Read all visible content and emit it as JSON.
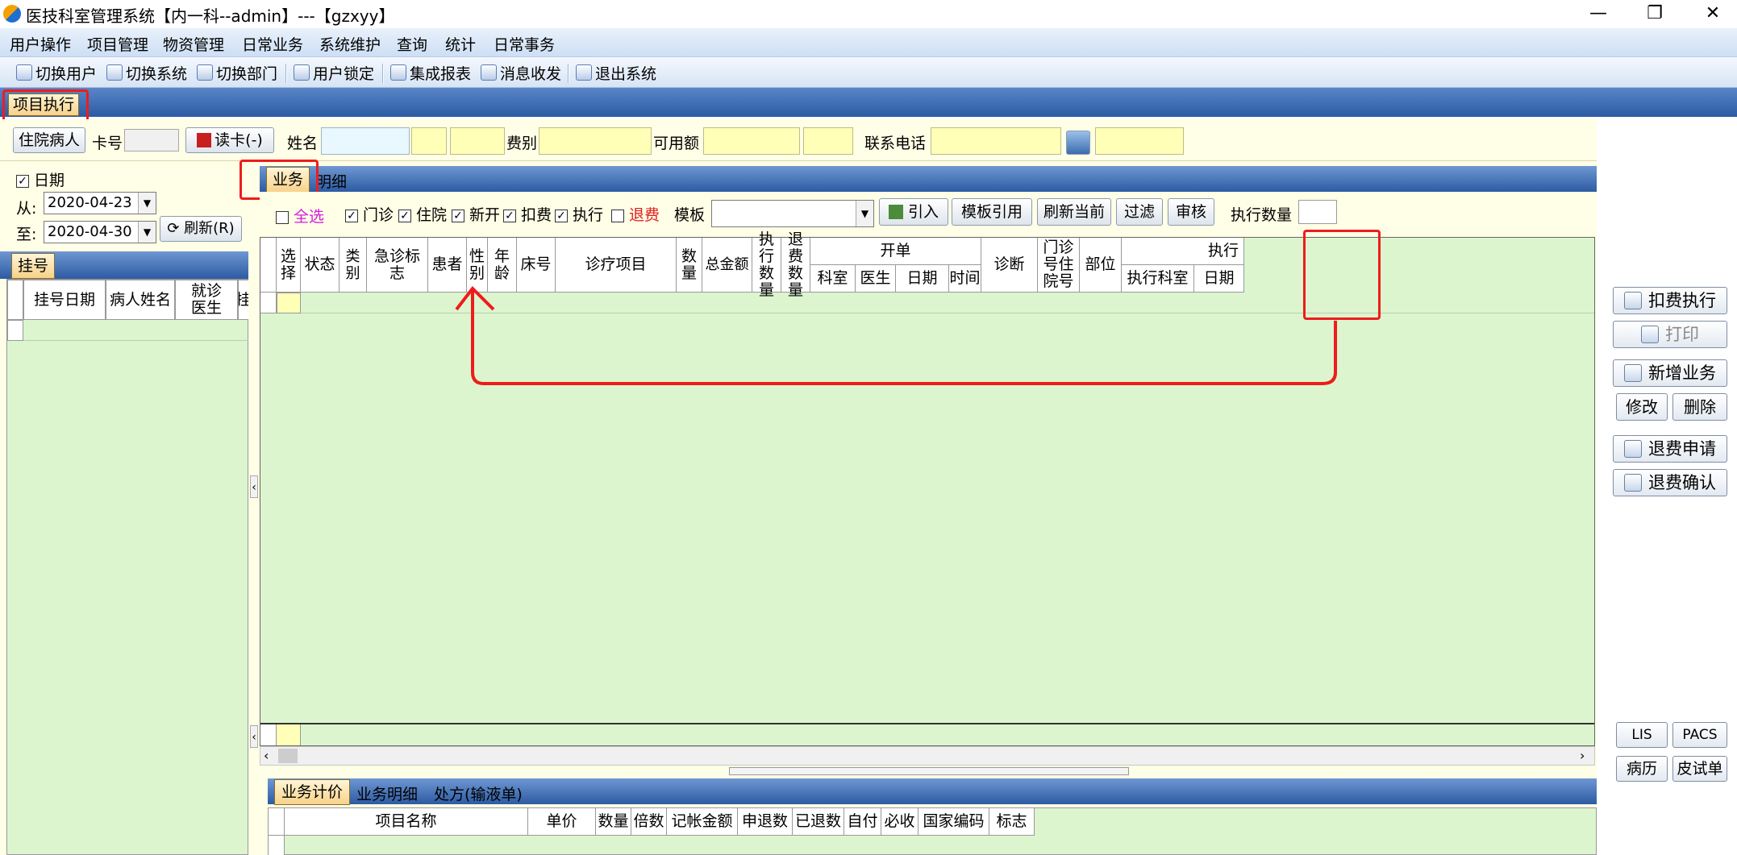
{
  "window": {
    "title": "医技科室管理系统【内一科--admin】---【gzxyy】"
  },
  "menu": [
    "用户操作",
    "项目管理",
    "物资管理",
    "日常业务",
    "系统维护",
    "查询",
    "统计",
    "日常事务"
  ],
  "toolbar": [
    {
      "label": "切换用户",
      "icon": "switch-user-icon"
    },
    {
      "label": "切换系统",
      "icon": "switch-system-icon"
    },
    {
      "label": "切换部门",
      "icon": "switch-dept-icon"
    },
    {
      "label": "用户锁定",
      "icon": "lock-user-icon"
    },
    {
      "label": "集成报表",
      "icon": "report-icon"
    },
    {
      "label": "消息收发",
      "icon": "message-icon"
    },
    {
      "label": "退出系统",
      "icon": "exit-icon"
    }
  ],
  "doc_tab": "项目执行",
  "info": {
    "inpatient_btn": "住院病人",
    "card_no": "卡号",
    "read_card": "读卡(-)",
    "name": "姓名",
    "fee_type": "费别",
    "available": "可用额",
    "phone": "联系电话"
  },
  "left": {
    "date_label": "日期",
    "from": "从:",
    "from_value": "2020-04-23",
    "to": "至:",
    "to_value": "2020-04-30",
    "refresh": "刷新(R)",
    "reg_tab": "挂号",
    "cols": [
      "挂号日期",
      "病人姓名",
      "就诊医生",
      "挂"
    ]
  },
  "main": {
    "tabs": [
      "业务",
      "明细"
    ],
    "filters": {
      "select_all": "全选",
      "outpatient": "门诊",
      "inpatient": "住院",
      "new_open": "新开",
      "charge": "扣费",
      "execute": "执行",
      "refund": "退费",
      "template": "模板",
      "import": "引入",
      "template_ref": "模板引用",
      "refresh_current": "刷新当前",
      "filter": "过滤",
      "audit": "审核",
      "exec_qty": "执行数量"
    },
    "cols": [
      "选择",
      "状态",
      "类别",
      "急诊标志",
      "患者",
      "性别",
      "年龄",
      "床号",
      "诊疗项目",
      "数量",
      "总金额",
      "执行数量",
      "退费数量",
      "开单",
      "科室",
      "医生",
      "日期",
      "时间",
      "诊断",
      "门诊号住院号",
      "部位",
      "执行",
      "执行科室",
      "日期"
    ]
  },
  "bottom": {
    "tabs": [
      "业务计价",
      "业务明细",
      "处方(输液单)"
    ],
    "cols": [
      "项目名称",
      "单价",
      "数量",
      "倍数",
      "记帐金额",
      "申退数",
      "已退数",
      "自付",
      "必收",
      "国家编码",
      "标志"
    ]
  },
  "right": {
    "charge_exec": "扣费执行",
    "print": "打印",
    "new_biz": "新增业务",
    "modify": "修改",
    "delete": "删除",
    "refund_apply": "退费申请",
    "refund_confirm": "退费确认",
    "lis": "LIS",
    "pacs": "PACS",
    "record": "病历",
    "skin_test": "皮试单"
  },
  "colors": {
    "annotation": "#ee1c1c",
    "grid": "#dcf5cf",
    "panel": "#fffee6",
    "yellow_input": "#ffffb8"
  }
}
